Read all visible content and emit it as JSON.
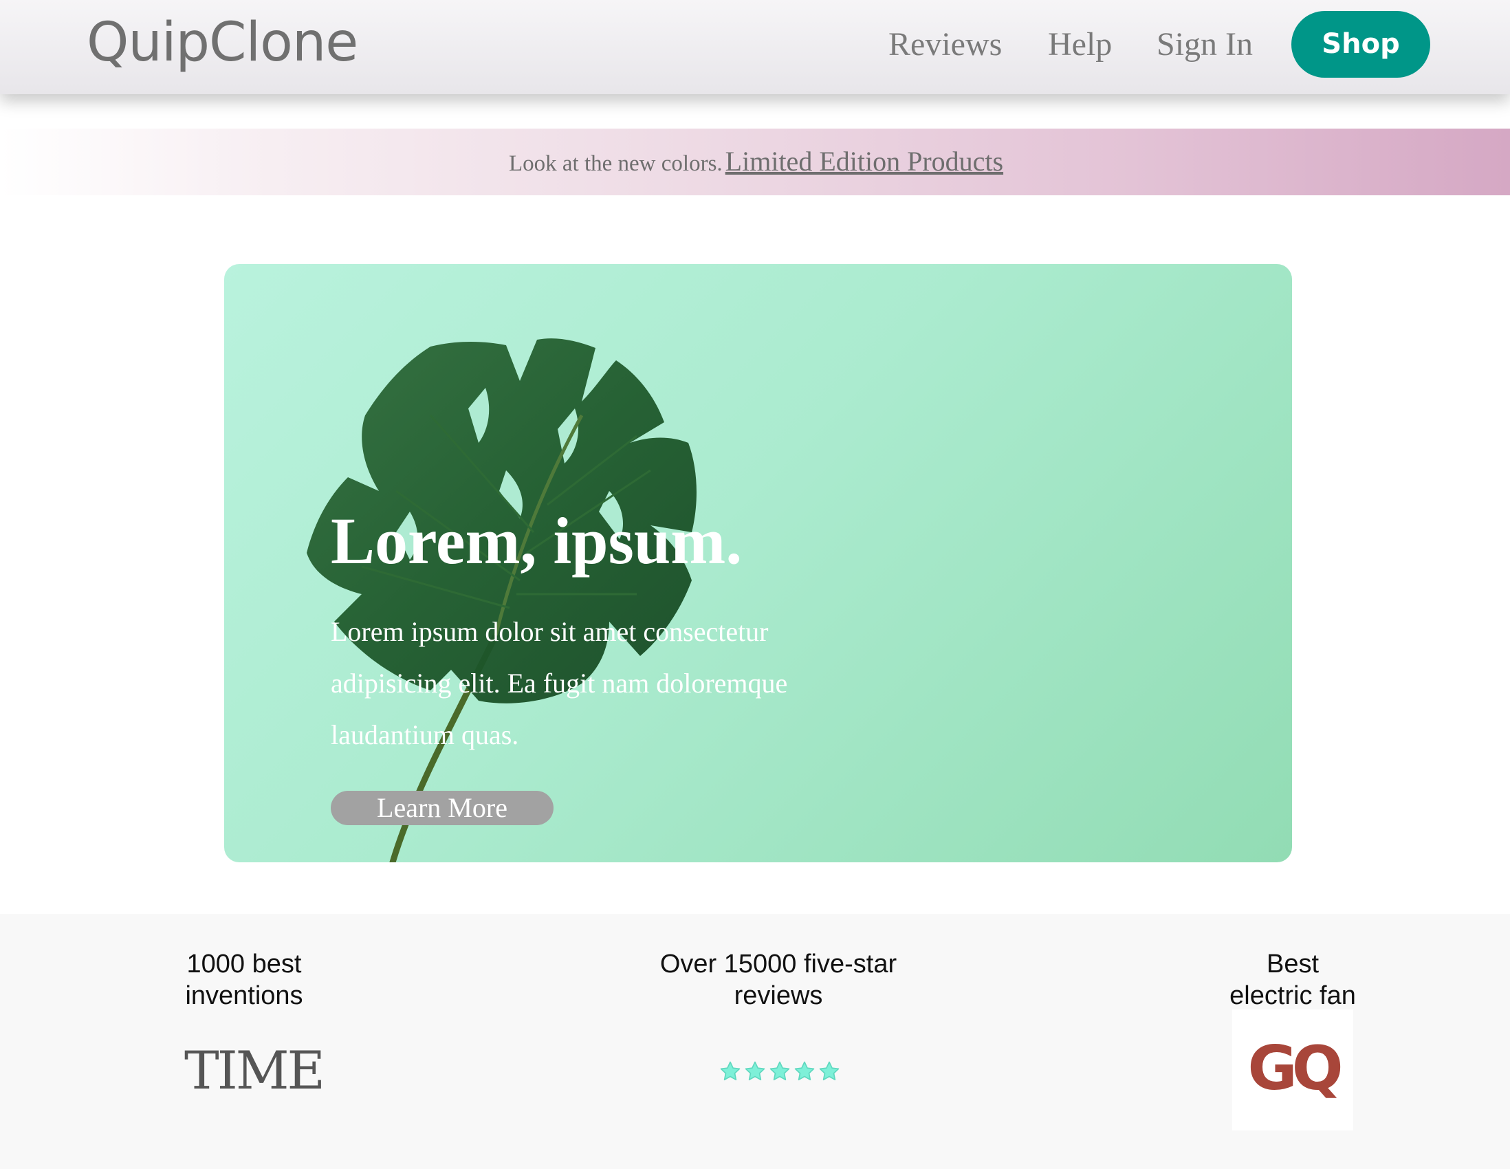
{
  "header": {
    "logo": "QuipClone",
    "nav": {
      "reviews": "Reviews",
      "help": "Help",
      "sign_in": "Sign In",
      "shop": "Shop"
    }
  },
  "banner": {
    "text": "Look at the new colors.",
    "link": "Limited Edition Products"
  },
  "hero": {
    "title": "Lorem, ipsum.",
    "body": "Lorem ipsum dolor sit amet consectetur adipisicing elit. Ea fugit nam doloremque laudantium quas.",
    "cta": "Learn More"
  },
  "press": {
    "time": {
      "caption_line1": "1000 best",
      "caption_line2": "inventions",
      "logo": "TIME"
    },
    "reviews": {
      "caption_line1": "Over 15000 five-star",
      "caption_line2": "reviews",
      "stars": 5
    },
    "gq": {
      "caption_line1": "Best",
      "caption_line2": "electric fan",
      "logo": "GQ"
    }
  },
  "colors": {
    "accent": "#009688",
    "star": "#7ef0d8",
    "gq_red": "#a8463a"
  }
}
